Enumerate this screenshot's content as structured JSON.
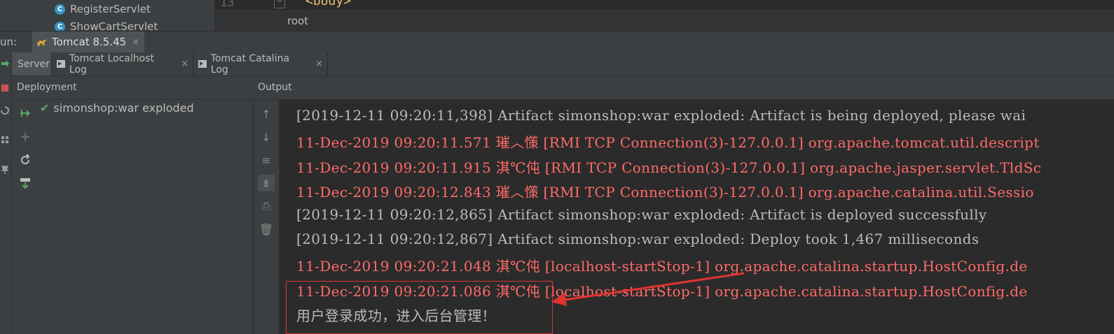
{
  "project_tree": {
    "items": [
      {
        "label": "RegisterServlet",
        "icon": "class-icon"
      },
      {
        "label": "ShowCartServlet",
        "icon": "class-icon"
      }
    ]
  },
  "editor": {
    "line_number": "13",
    "code": "<body>",
    "breadcrumb": "root"
  },
  "run_bar": {
    "label": "un:",
    "tab_label": "Tomcat 8.5.45",
    "close_glyph": "×"
  },
  "sub_tabs": [
    {
      "label": "Server",
      "selected": true
    },
    {
      "label": "Tomcat Localhost Log",
      "selected": false
    },
    {
      "label": "Tomcat Catalina Log",
      "selected": false
    }
  ],
  "headers": {
    "deployment": "Deployment",
    "output": "Output"
  },
  "deployment": {
    "item": "simonshop:war exploded",
    "status_icon": "check-icon"
  },
  "console": {
    "lines": [
      {
        "text": "[2019-12-11 09:20:11,398] Artifact simonshop:war exploded: Artifact is being deployed, please wai",
        "level": "info"
      },
      {
        "text": "11-Dec-2019 09:20:11.571 璀︿憡 [RMI TCP Connection(3)-127.0.0.1] org.apache.tomcat.util.descript",
        "level": "err"
      },
      {
        "text": "11-Dec-2019 09:20:11.915 淇℃伅 [RMI TCP Connection(3)-127.0.0.1] org.apache.jasper.servlet.TldSc",
        "level": "err"
      },
      {
        "text": "11-Dec-2019 09:20:12.843 璀︿憡 [RMI TCP Connection(3)-127.0.0.1] org.apache.catalina.util.Sessio",
        "level": "err"
      },
      {
        "text": "[2019-12-11 09:20:12,865] Artifact simonshop:war exploded: Artifact is deployed successfully",
        "level": "info"
      },
      {
        "text": "[2019-12-11 09:20:12,867] Artifact simonshop:war exploded: Deploy took 1,467 milliseconds",
        "level": "info"
      },
      {
        "text": "11-Dec-2019 09:20:21.048 淇℃伅 [localhost-startStop-1] org.apache.catalina.startup.HostConfig.de",
        "level": "err"
      },
      {
        "text": "11-Dec-2019 09:20:21.086 淇℃伅 [localhost-startStop-1] org.apache.catalina.startup.HostConfig.de",
        "level": "err"
      },
      {
        "text": "用户登录成功，进入后台管理！",
        "level": "info"
      }
    ]
  },
  "colors": {
    "error_text": "#ff6b68",
    "info_text": "#bbbbbb",
    "annotation": "#e0332f"
  }
}
